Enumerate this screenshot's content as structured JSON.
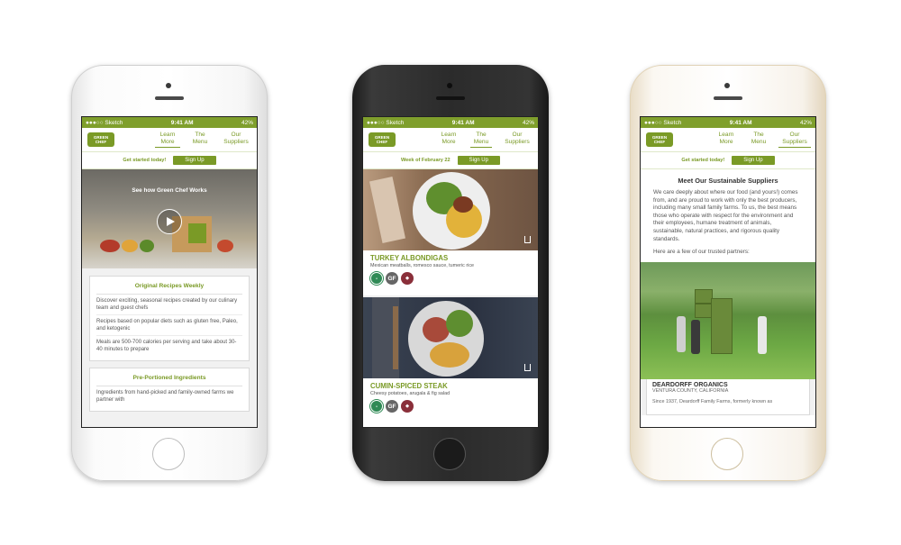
{
  "status_bar": {
    "carrier": "●●●○○ Sketch",
    "time": "9:41 AM",
    "battery": "42%"
  },
  "logo": {
    "line1": "GREEN",
    "line2": "CHEF"
  },
  "nav": {
    "learn": "Learn More",
    "menu": "The Menu",
    "suppliers": "Our Suppliers"
  },
  "screen1": {
    "cta_text": "Get started today!",
    "cta_button": "Sign Up",
    "hero_title": "See how Green Chef Works",
    "cards": [
      {
        "title": "Original Recipes Weekly",
        "items": [
          "Discover exciting, seasonal recipes created by our culinary team and guest chefs",
          "Recipes based on popular diets such as gluten free, Paleo, and ketogenic",
          "Meals are 500-700 calories per serving and take about 30-40 minutes to prepare"
        ]
      },
      {
        "title": "Pre-Portioned Ingredients",
        "items": [
          "Ingredients from hand-picked and family-owned farms we partner with"
        ]
      }
    ]
  },
  "screen2": {
    "week_label": "Week of February 22",
    "cta_button": "Sign Up",
    "dishes": [
      {
        "name": "TURKEY ALBONDIGAS",
        "desc": "Mexican meatballs, romesco sauce, tumeric rice"
      },
      {
        "name": "CUMIN-SPICED STEAK",
        "desc": "Cheesy potatoes, arugala & fig salad"
      }
    ],
    "badge_gf": "GF"
  },
  "screen3": {
    "cta_text": "Get started today!",
    "cta_button": "Sign Up",
    "heading": "Meet Our Sustainable Suppliers",
    "para1": "We care deeply about where our food (and yours!) comes from, and are proud to work with only the best producers, including many small family farms. To us, the best means those who operate with respect for the environment and their employees, humane treatment of animals, sustainable, natural practices, and rigorous quality standards.",
    "para2": "Here are a few of our trusted partners:",
    "farm_name": "DEARDORFF ORGANICS",
    "farm_location": "VENTURA COUNTY, CALIFORNIA",
    "farm_text": "Since 1937, Deardorff Family Farms, formerly known as"
  },
  "colors": {
    "brand_green": "#7a9a26",
    "status_green": "#7f9f2c"
  }
}
